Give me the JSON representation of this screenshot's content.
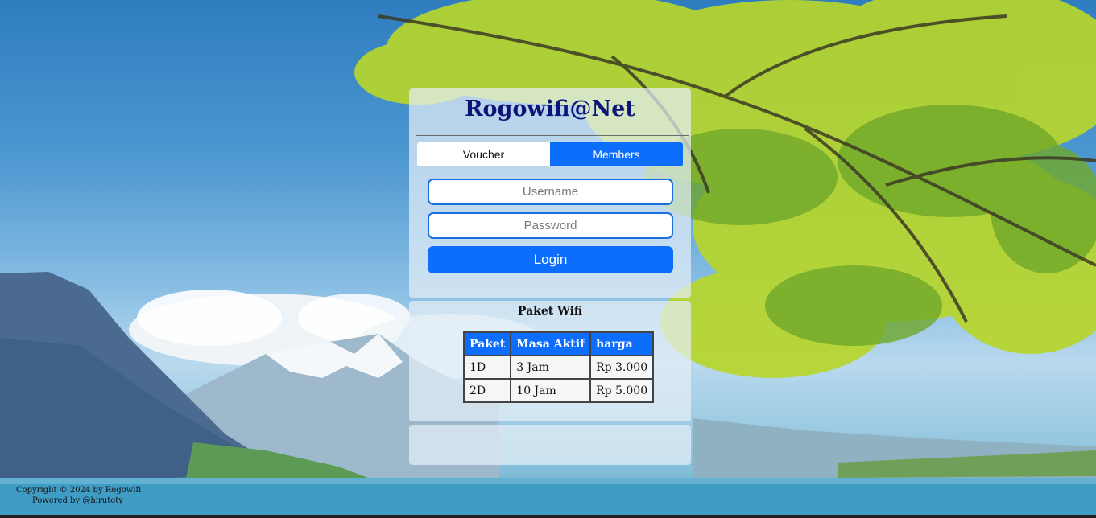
{
  "brand": {
    "title": "Rogowifi@Net"
  },
  "tabs": [
    {
      "label": "Voucher",
      "active": false
    },
    {
      "label": "Members",
      "active": true
    }
  ],
  "login_form": {
    "username_placeholder": "Username",
    "password_placeholder": "Password",
    "login_label": "Login"
  },
  "paket": {
    "title": "Paket Wifi",
    "headers": [
      "Paket",
      "Masa Aktif",
      "harga"
    ],
    "rows": [
      [
        "1D",
        "3 Jam",
        "Rp 3.000"
      ],
      [
        "2D",
        "10 Jam",
        "Rp 5.000"
      ]
    ]
  },
  "footer": {
    "copyright": "Copyright © 2024 by Rogowifi",
    "powered_prefix": "Powered by ",
    "powered_link": "@hirutoty"
  },
  "colors": {
    "accent": "#0d6efd",
    "brand_title": "#0d1478"
  }
}
